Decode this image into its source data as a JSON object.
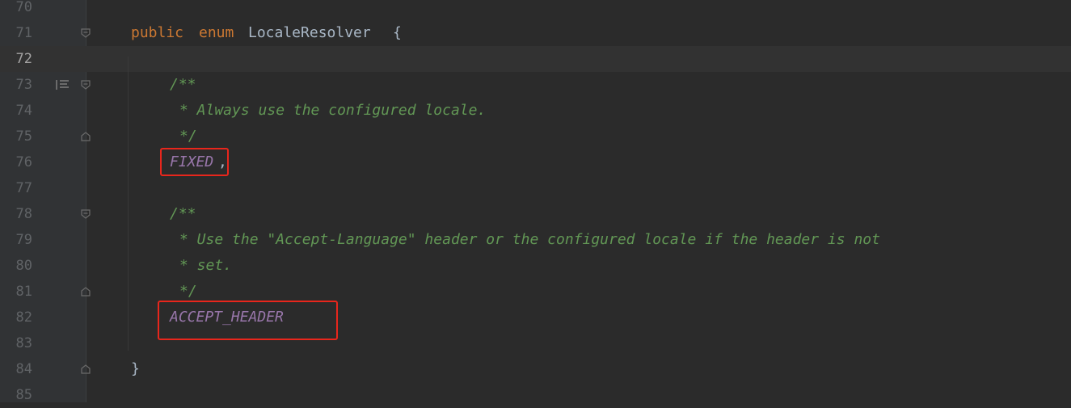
{
  "editor": {
    "lines": [
      {
        "n": "70"
      },
      {
        "n": "71",
        "parts": [
          "public",
          "enum",
          "LocaleResolver",
          "{"
        ]
      },
      {
        "n": "72"
      },
      {
        "n": "73",
        "text": "/**"
      },
      {
        "n": "74",
        "text": "* Always use the configured locale."
      },
      {
        "n": "75",
        "text": "*/"
      },
      {
        "n": "76",
        "const": "FIXED",
        "punct": ","
      },
      {
        "n": "77"
      },
      {
        "n": "78",
        "text": "/**"
      },
      {
        "n": "79",
        "text": "* Use the \"Accept-Language\" header or the configured locale if the header is not"
      },
      {
        "n": "80",
        "text": "* set."
      },
      {
        "n": "81",
        "text": "*/"
      },
      {
        "n": "82",
        "const": "ACCEPT_HEADER"
      },
      {
        "n": "83"
      },
      {
        "n": "84",
        "text": "}"
      },
      {
        "n": "85"
      }
    ]
  },
  "colors": {
    "background": "#2b2b2b",
    "gutter": "#313335",
    "keyword": "#cc7832",
    "identifier": "#a9b7c6",
    "doc_comment": "#629755",
    "enum_constant": "#9876aa",
    "highlight_box": "#e8261c"
  },
  "icons": {
    "fold": "fold-marker-icon",
    "bookmark": "structure-icon"
  }
}
